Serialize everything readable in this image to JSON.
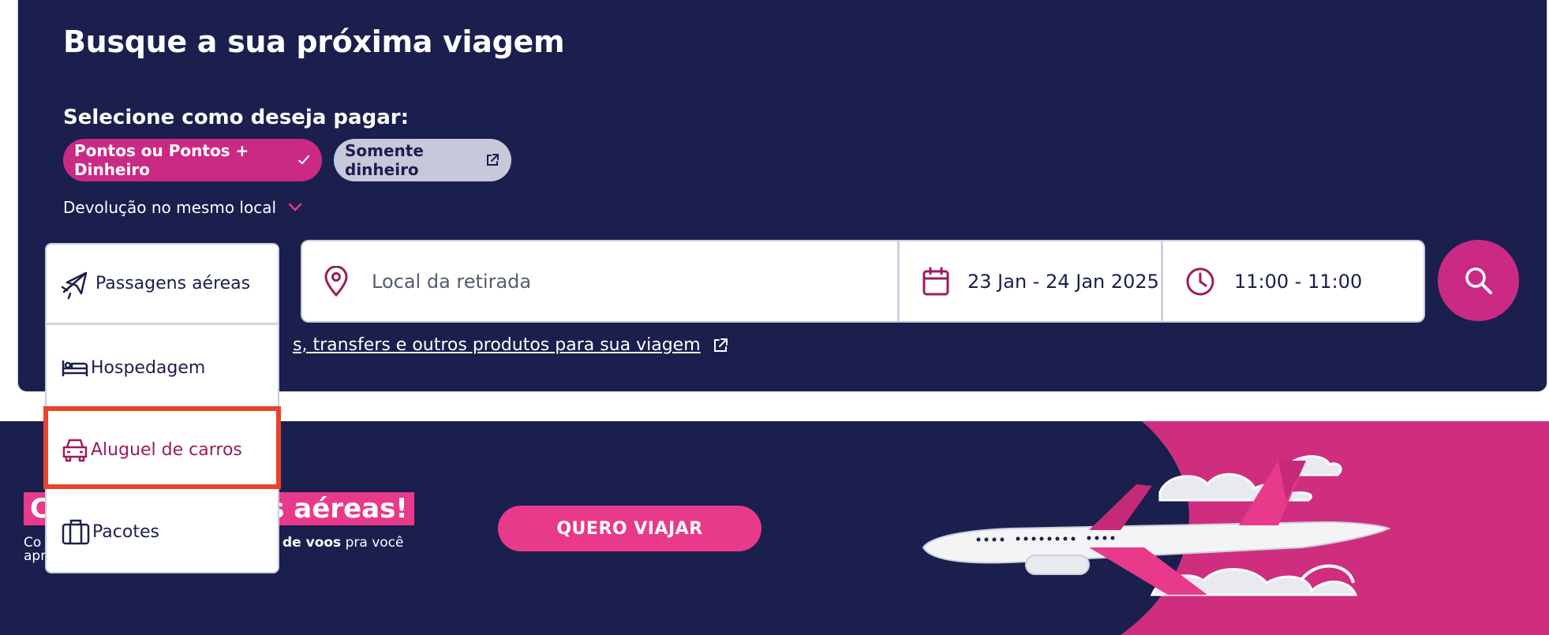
{
  "search": {
    "title": "Busque a sua próxima viagem",
    "pay_label": "Selecione como deseja pagar:",
    "pay_options": [
      {
        "label": "Pontos ou Pontos + Dinheiro",
        "selected": true,
        "icon": "check-icon"
      },
      {
        "label": "Somente dinheiro",
        "selected": false,
        "icon": "external-link-icon"
      }
    ],
    "return_option": "Devolução no mesmo local",
    "location_placeholder": "Local da retirada",
    "dates": "23 Jan - 24 Jan 2025",
    "times": "11:00 - 11:00",
    "extras_link": "s, transfers e outros produtos para sua viagem"
  },
  "product_menu": {
    "items": [
      {
        "label": "Passagens aéreas",
        "icon": "airplane-icon"
      },
      {
        "label": "Hospedagem",
        "icon": "bed-icon"
      },
      {
        "label": "Aluguel de carros",
        "icon": "car-icon",
        "highlighted": true
      },
      {
        "label": "Pacotes",
        "icon": "suitcase-icon"
      }
    ]
  },
  "banner": {
    "headline_left": "C",
    "headline_right": "ens aéreas!",
    "sub_line1_a": "Co",
    "sub_line1_b": "os de voos",
    "sub_line1_c": " pra você",
    "sub_line2": "apr",
    "cta": "QUERO VIAJAR"
  },
  "colors": {
    "navy": "#1a1f4e",
    "magenta": "#cb2a84",
    "pink": "#e8398a",
    "highlight": "#e8432c"
  }
}
